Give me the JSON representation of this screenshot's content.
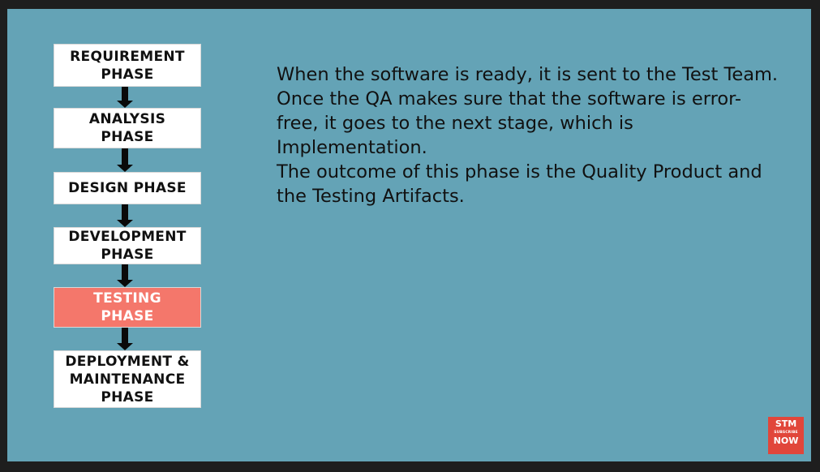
{
  "phases": [
    {
      "label": "REQUIREMENT\nPHASE",
      "active": false
    },
    {
      "label": "ANALYSIS\nPHASE",
      "active": false
    },
    {
      "label": "DESIGN PHASE",
      "active": false
    },
    {
      "label": "DEVELOPMENT\nPHASE",
      "active": false
    },
    {
      "label": "TESTING\nPHASE",
      "active": true
    },
    {
      "label": "DEPLOYMENT &\nMAINTENANCE\nPHASE",
      "active": false
    }
  ],
  "description": {
    "paragraph1": "When the software is ready, it is sent to the Test Team. Once the QA makes sure that the software is error-free, it goes to the next stage, which is Implementation.",
    "paragraph2": "The outcome of this phase is the Quality Product and the Testing Artifacts."
  },
  "badge": {
    "line1": "STM",
    "line2": "SUBSCRIBE",
    "line3": "NOW"
  },
  "colors": {
    "slide_background": "#64a3b6",
    "active_phase": "#f4776b",
    "badge": "#e1463a"
  }
}
